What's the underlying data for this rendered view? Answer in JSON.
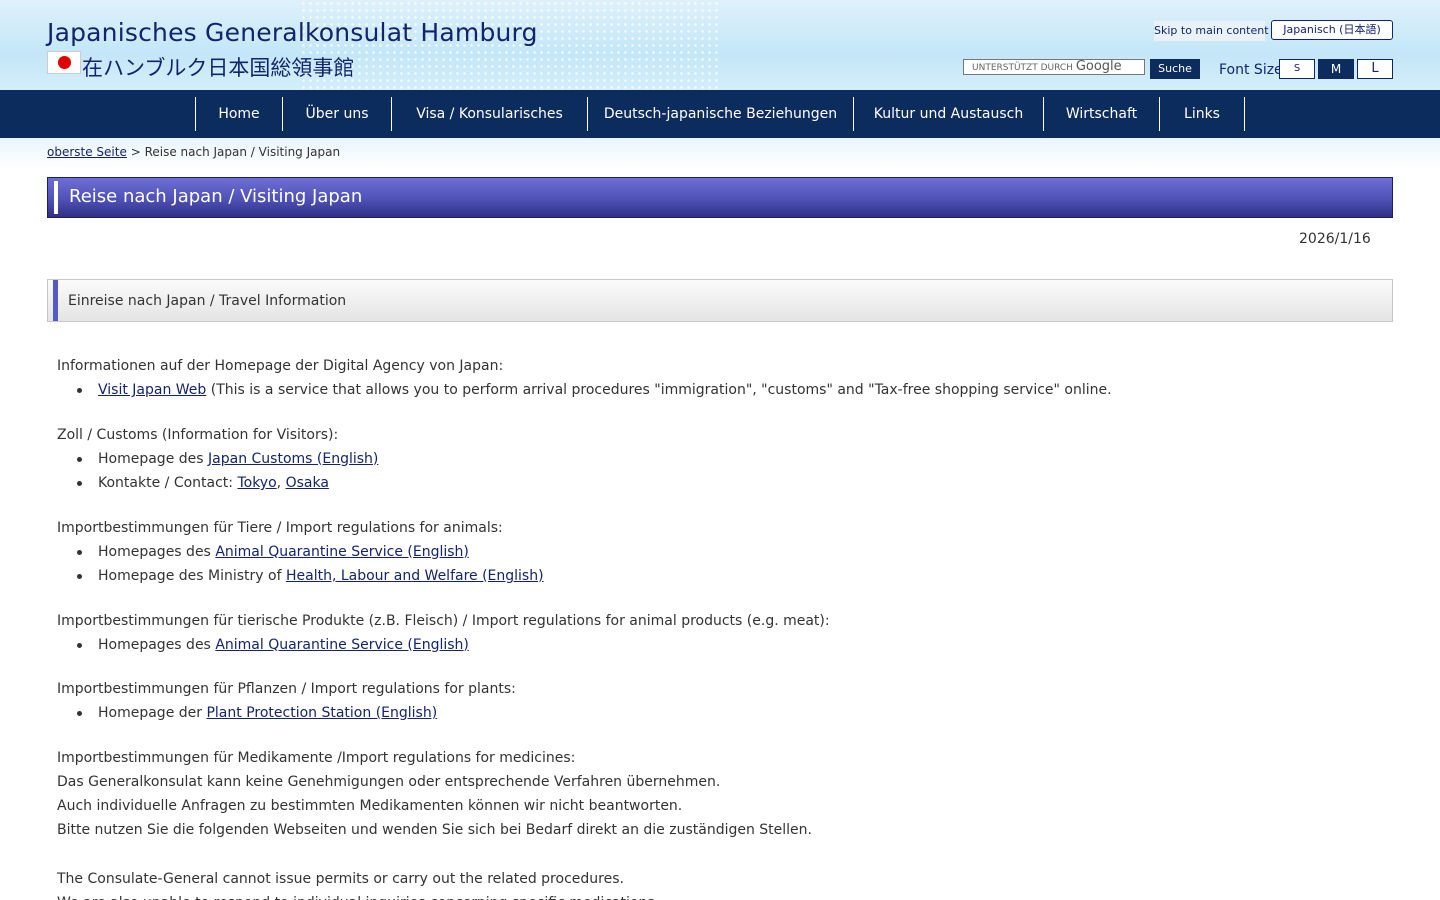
{
  "header": {
    "title": "Japanisches Generalkonsulat Hamburg",
    "subtitle": "在ハンブルク日本国総領事館",
    "skip_link": "Skip to main content",
    "language_button": "Japanisch (日本語)",
    "search": {
      "placeholder_prefix": "UNTERSTÜTZT DURCH",
      "placeholder_brand": "Google",
      "button": "Suche"
    },
    "font_size": {
      "label": "Font Size",
      "options": [
        "S",
        "M",
        "L"
      ],
      "selected": "M"
    }
  },
  "nav": {
    "items": [
      "Home",
      "Über uns",
      "Visa / Konsularisches",
      "Deutsch-japanische Beziehungen",
      "Kultur und Austausch",
      "Wirtschaft",
      "Links"
    ]
  },
  "breadcrumb": {
    "home": "oberste Seite",
    "separator": ">",
    "current": "Reise nach Japan / Visiting Japan"
  },
  "page": {
    "title": "Reise nach Japan / Visiting Japan",
    "date": "2026/1/16",
    "section_title": "Einreise nach Japan / Travel Information"
  },
  "content": {
    "digital": {
      "heading": "Informationen auf der Homepage der Digital Agency von Japan:",
      "item_link": "Visit Japan Web",
      "item_text": " (This is a service that allows you to perform arrival procedures \"immigration\", \"customs\" and \"Tax-free shopping service\" online."
    },
    "customs": {
      "heading": "Zoll / Customs (Information for Visitors):",
      "item1_prefix": "Homepage des ",
      "item1_link": "Japan Customs (English)",
      "item2_prefix": "Kontakte / Contact: ",
      "item2_link1": "Tokyo",
      "item2_sep": ", ",
      "item2_link2": "Osaka"
    },
    "animals": {
      "heading": "Importbestimmungen für Tiere / Import regulations for animals:",
      "item1_prefix": "Homepages des ",
      "item1_link": "Animal Quarantine Service (English)",
      "item2_prefix": "Homepage des Ministry of ",
      "item2_link": "Health, Labour and Welfare (English)"
    },
    "animal_products": {
      "heading": "Importbestimmungen für tierische Produkte (z.B. Fleisch) / Import regulations for animal products (e.g. meat):",
      "item1_prefix": "Homepages des ",
      "item1_link": "Animal Quarantine Service (English)"
    },
    "plants": {
      "heading": "Importbestimmungen für Pflanzen / Import regulations for plants:",
      "item1_prefix": "Homepage der ",
      "item1_link": "Plant Protection Station (English)"
    },
    "medicines": {
      "heading": "Importbestimmungen für Medikamente /Import regulations for medicines:",
      "line1": "Das Generalkonsulat kann keine Genehmigungen oder entsprechende Verfahren übernehmen.",
      "line2": "Auch individuelle Anfragen zu bestimmten Medikamenten können wir nicht beantworten.",
      "line3": "Bitte nutzen Sie die folgenden Webseiten und wenden Sie sich bei Bedarf direkt an die zuständigen Stellen.",
      "en_line1": "The Consulate-General cannot issue permits or carry out the related procedures.",
      "en_line2": "We are also unable to respond to individual inquiries concerning specific medications."
    }
  },
  "colors": {
    "navy": "#0d2c5e",
    "title_text": "#13246b",
    "title_bar": "#4f51b6",
    "flag_red": "#e00000"
  }
}
